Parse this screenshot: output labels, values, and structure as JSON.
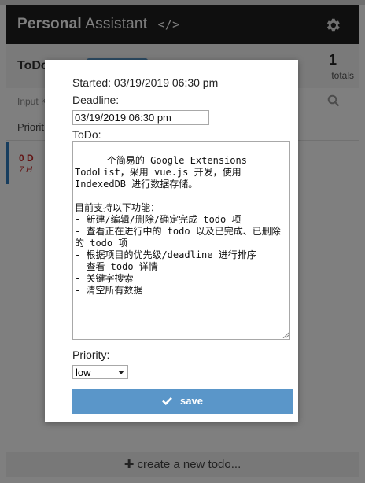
{
  "app": {
    "title_bold": "Personal",
    "title_rest": "Assistant",
    "title_code": "</>"
  },
  "list": {
    "title": "ToDo",
    "count": "1",
    "totals_label": "totals",
    "search_placeholder": "Input K",
    "priority_label": "Priorit",
    "item_days": "0 D",
    "item_hours": "7 H",
    "create_label": "create a new todo..."
  },
  "modal": {
    "started": "Started: 03/19/2019 06:30 pm",
    "deadline_label": "Deadline:",
    "deadline_value": "03/19/2019 06:30 pm",
    "todo_label": "ToDo:",
    "todo_text": "一个简易的 Google Extensions TodoList，采用 vue.js 开发，使用 IndexedDB 进行数据存储。\n\n目前支持以下功能：\n- 新建/编辑/删除/确定完成 todo 项\n- 查看正在进行中的 todo 以及已完成、已删除的 todo 项\n- 根据项目的优先级/deadline 进行排序\n- 查看 todo 详情\n- 关键字搜索\n- 清空所有数据",
    "priority_label": "Priority:",
    "priority_value": "low",
    "save_label": "save"
  },
  "colors": {
    "accent": "#5a96c9",
    "appbar": "#1f1f1f",
    "overdue": "#c62828"
  },
  "icons": [
    "gear-icon",
    "search-icon",
    "check-icon",
    "plus-icon"
  ]
}
